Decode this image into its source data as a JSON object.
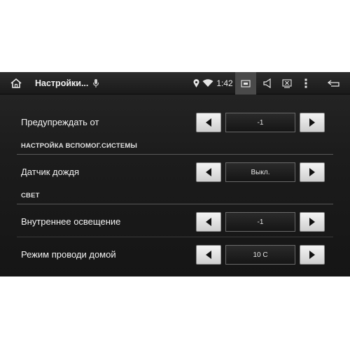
{
  "topbar": {
    "title": "Настройки...",
    "clock": "1:42"
  },
  "icons": [
    "home-icon",
    "mic-icon",
    "location-icon",
    "wifi-icon",
    "screenshot-icon",
    "volume-icon",
    "close-app-icon",
    "menu-icon",
    "back-icon"
  ],
  "rows": [
    {
      "label": "Предупреждать от",
      "value": "-1"
    },
    {
      "label": "Датчик дождя",
      "value": "Выкл."
    },
    {
      "label": "Внутреннее освещение",
      "value": "-1"
    },
    {
      "label": "Режим проводи домой",
      "value": "10 С"
    }
  ],
  "sections": [
    {
      "label": "НАСТРОЙКА ВСПОМОГ.СИСТЕМЫ"
    },
    {
      "label": "СВЕТ"
    }
  ],
  "colors": {
    "background": "#1c1c1c",
    "button": "#e6e6e6",
    "text": "#f2f2f2"
  }
}
